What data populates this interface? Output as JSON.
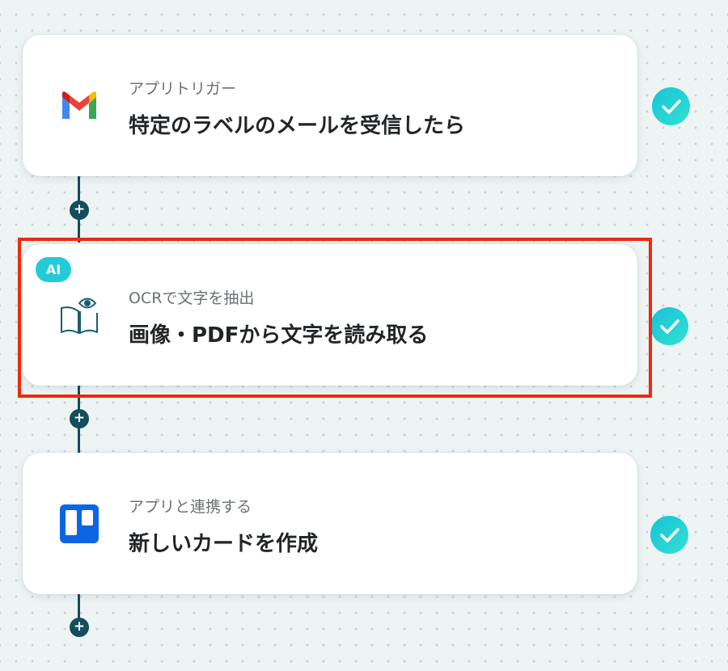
{
  "flow": {
    "steps": [
      {
        "subtitle": "アプリトリガー",
        "title": "特定のラベルのメールを受信したら",
        "icon": "gmail-icon",
        "status": "complete"
      },
      {
        "badge": "AI",
        "subtitle": "OCRで文字を抽出",
        "title": "画像・PDFから文字を読み取る",
        "icon": "book-eye-icon",
        "status": "complete",
        "highlighted": true
      },
      {
        "subtitle": "アプリと連携する",
        "title": "新しいカードを作成",
        "icon": "trello-icon",
        "status": "complete"
      }
    ],
    "add_step_label": "+"
  },
  "colors": {
    "connector": "#124e5c",
    "check": "#22cbd8",
    "ai_badge": "#22cbd8",
    "highlight": "#ec2a0c",
    "gmail_red": "#ea4335",
    "gmail_blue": "#4285f4",
    "gmail_green": "#34a853",
    "gmail_yellow": "#fbbc04",
    "trello_blue": "#0c66e4",
    "book_icon": "#1a5d72"
  }
}
